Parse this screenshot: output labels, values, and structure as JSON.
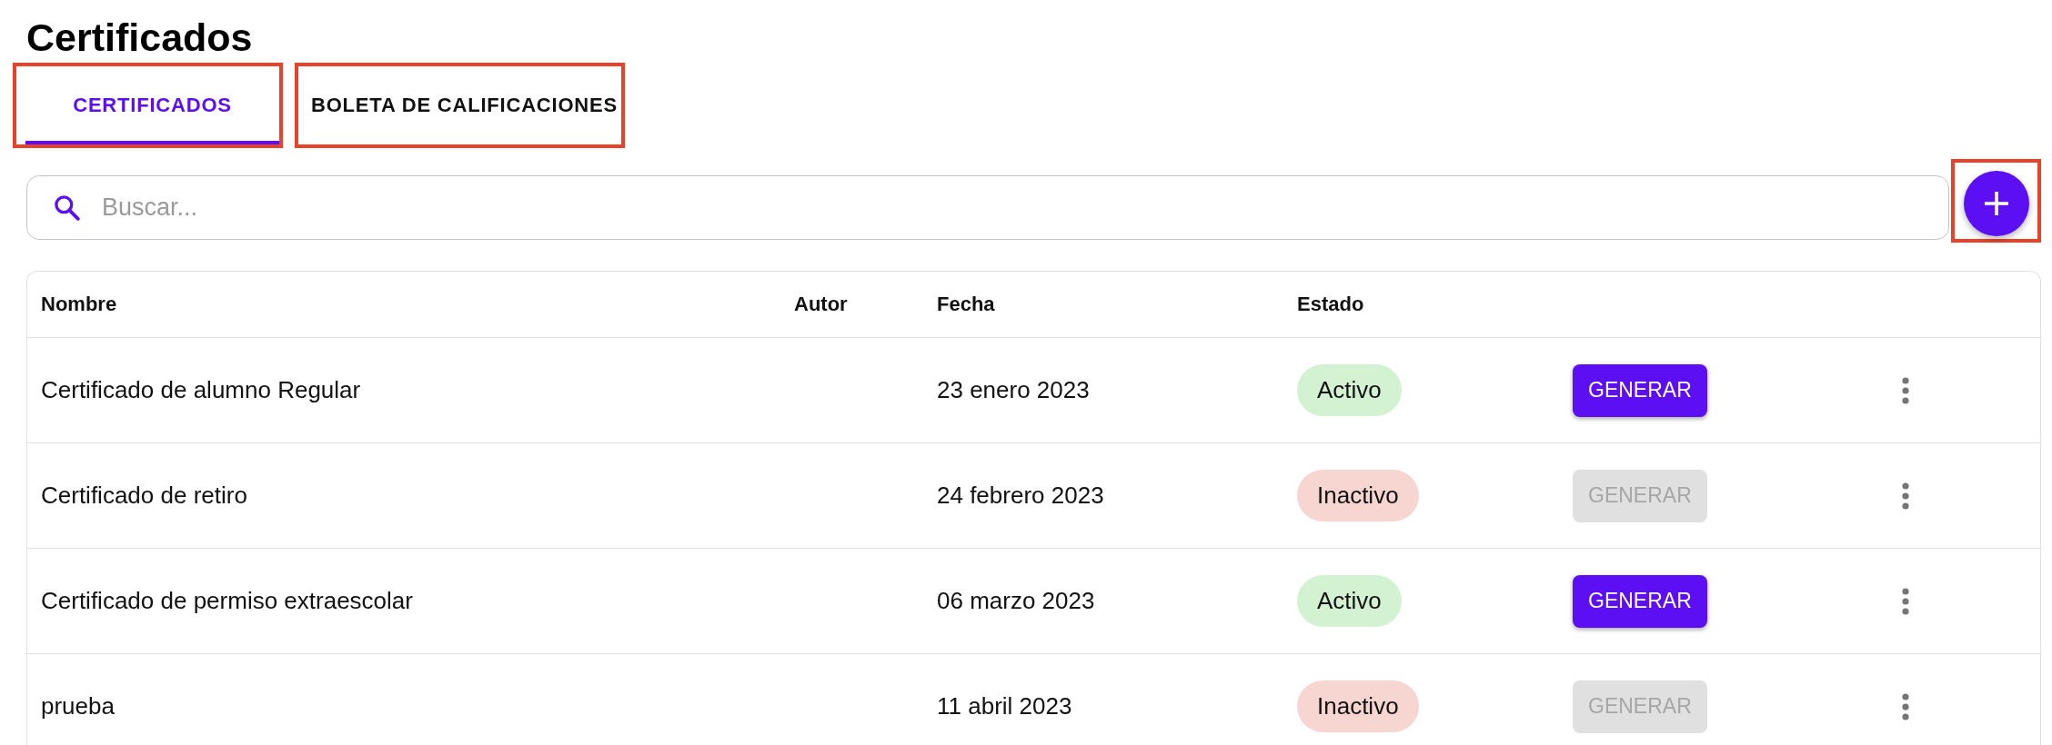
{
  "page": {
    "title": "Certificados"
  },
  "tabs": [
    {
      "label": "CERTIFICADOS",
      "selected": true,
      "highlighted": true
    },
    {
      "label": "BOLETA DE CALIFICACIONES",
      "selected": false,
      "highlighted": true
    }
  ],
  "search": {
    "placeholder": "Buscar..."
  },
  "add_button": {
    "highlighted": true
  },
  "table": {
    "columns": [
      "Nombre",
      "Autor",
      "Fecha",
      "Estado"
    ],
    "rows": [
      {
        "name": "Certificado de alumno Regular",
        "date": "23 enero 2023",
        "status": "Activo",
        "active": true,
        "action": {
          "label": "GENERAR",
          "disabled": false
        }
      },
      {
        "name": "Certificado de retiro",
        "date": "24 febrero 2023",
        "status": "Inactivo",
        "active": false,
        "action": {
          "label": "GENERAR",
          "disabled": true
        }
      },
      {
        "name": "Certificado de permiso extraescolar",
        "date": "06 marzo 2023",
        "status": "Activo",
        "active": true,
        "action": {
          "label": "GENERAR",
          "disabled": false
        }
      },
      {
        "name": "prueba",
        "date": "11 abril 2023",
        "status": "Inactivo",
        "active": false,
        "action": {
          "label": "GENERAR",
          "disabled": true
        }
      }
    ]
  }
}
